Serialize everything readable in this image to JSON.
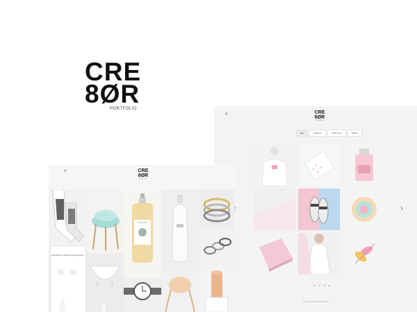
{
  "brand": {
    "line1": "CRE",
    "line2": "8ØR",
    "tagline": "PORTFOLIO"
  },
  "right_screen": {
    "menu_icon": "hamburger-icon",
    "logo_line1": "CRE",
    "logo_line2": "8ØR",
    "logo_tagline": "PORTFOLIO",
    "filters": [
      "ALL",
      "DESIGN",
      "CREATIVE",
      "MEDIA"
    ],
    "prev_arrow": "‹",
    "next_arrow": "›",
    "pager": "1 2 3 ▸",
    "footer": "Creator Creative Portfolio ©"
  },
  "left_screen": {
    "menu_icon": "hamburger-icon",
    "logo_line1": "CRE",
    "logo_line2": "8ØR",
    "logo_tagline": "PORTFOLIO",
    "card_text": "Minimalism speaks through figures",
    "bottle_label": "The Craft"
  },
  "colors": {
    "background": "#ffffff",
    "screen_bg": "#f3f3f3",
    "pink": "#f2c9d4",
    "blue": "#b9d5ec",
    "text": "#111111"
  }
}
